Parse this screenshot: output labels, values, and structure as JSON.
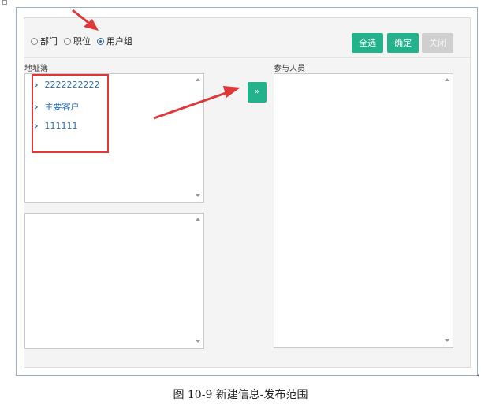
{
  "scope": {
    "radios": [
      {
        "label": "部门",
        "selected": false
      },
      {
        "label": "职位",
        "selected": false
      },
      {
        "label": "用户组",
        "selected": true
      }
    ],
    "buttons": {
      "select_all": "全选",
      "confirm": "确定",
      "close": "关闭"
    },
    "address_book": {
      "title": "地址簿",
      "items": [
        "2222222222",
        "主要客户",
        "111111"
      ]
    },
    "participants": {
      "title": "参与人员"
    },
    "move_button": "»"
  },
  "caption": "图 10-9  新建信息-发布范围",
  "colors": {
    "accent": "#24b28d",
    "link": "#2a6db0",
    "annotation": "#e03838",
    "disabled": "#cfcfcf"
  }
}
